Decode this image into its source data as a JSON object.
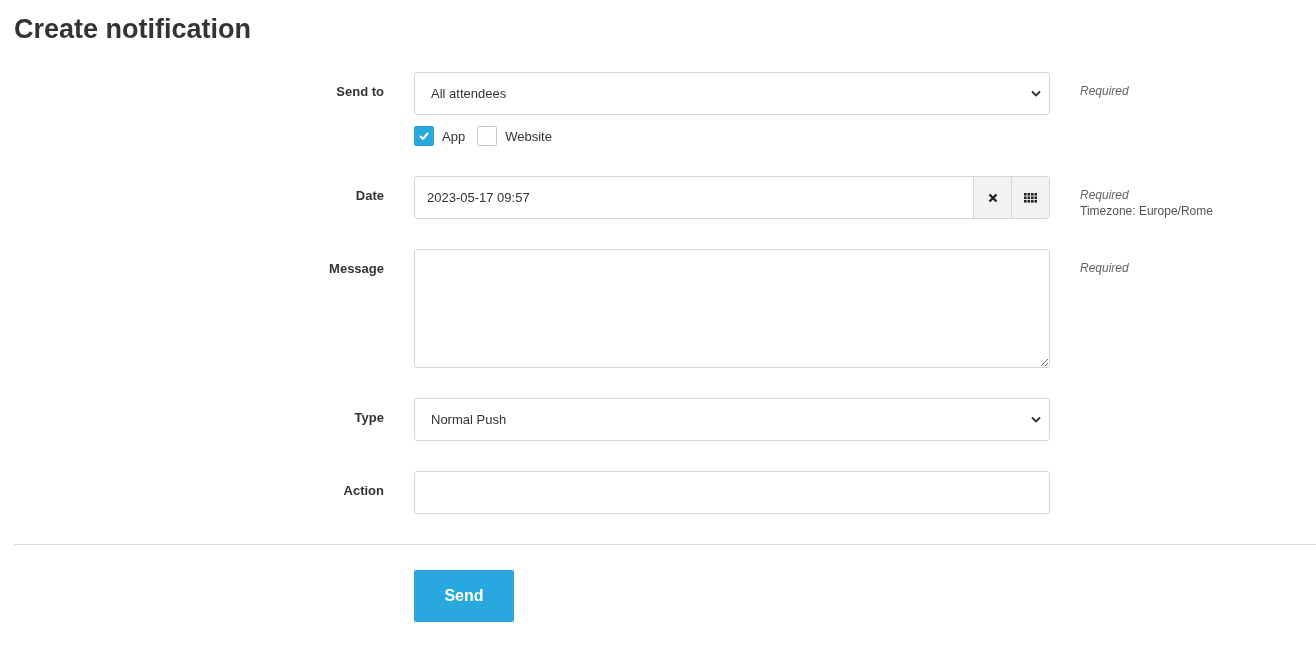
{
  "title": "Create notification",
  "fields": [
    {
      "kind": "select",
      "label": "Send to",
      "value": "All attendees",
      "hints": [
        {
          "kind": "required",
          "text": "Required"
        }
      ],
      "options": [
        {
          "label": "App",
          "checked": true
        },
        {
          "label": "Website",
          "checked": false
        }
      ]
    },
    {
      "kind": "datetime",
      "label": "Date",
      "value": "2023-05-17 09:57",
      "hints": [
        {
          "kind": "required",
          "text": "Required"
        },
        {
          "kind": "note",
          "text": "Timezone: Europe/Rome"
        }
      ]
    },
    {
      "kind": "textarea",
      "label": "Message",
      "hints": [
        {
          "kind": "required",
          "text": "Required"
        }
      ]
    },
    {
      "kind": "select",
      "label": "Type",
      "value": "Normal Push"
    },
    {
      "kind": "input",
      "label": "Action"
    }
  ],
  "submit": {
    "label": "Send"
  }
}
